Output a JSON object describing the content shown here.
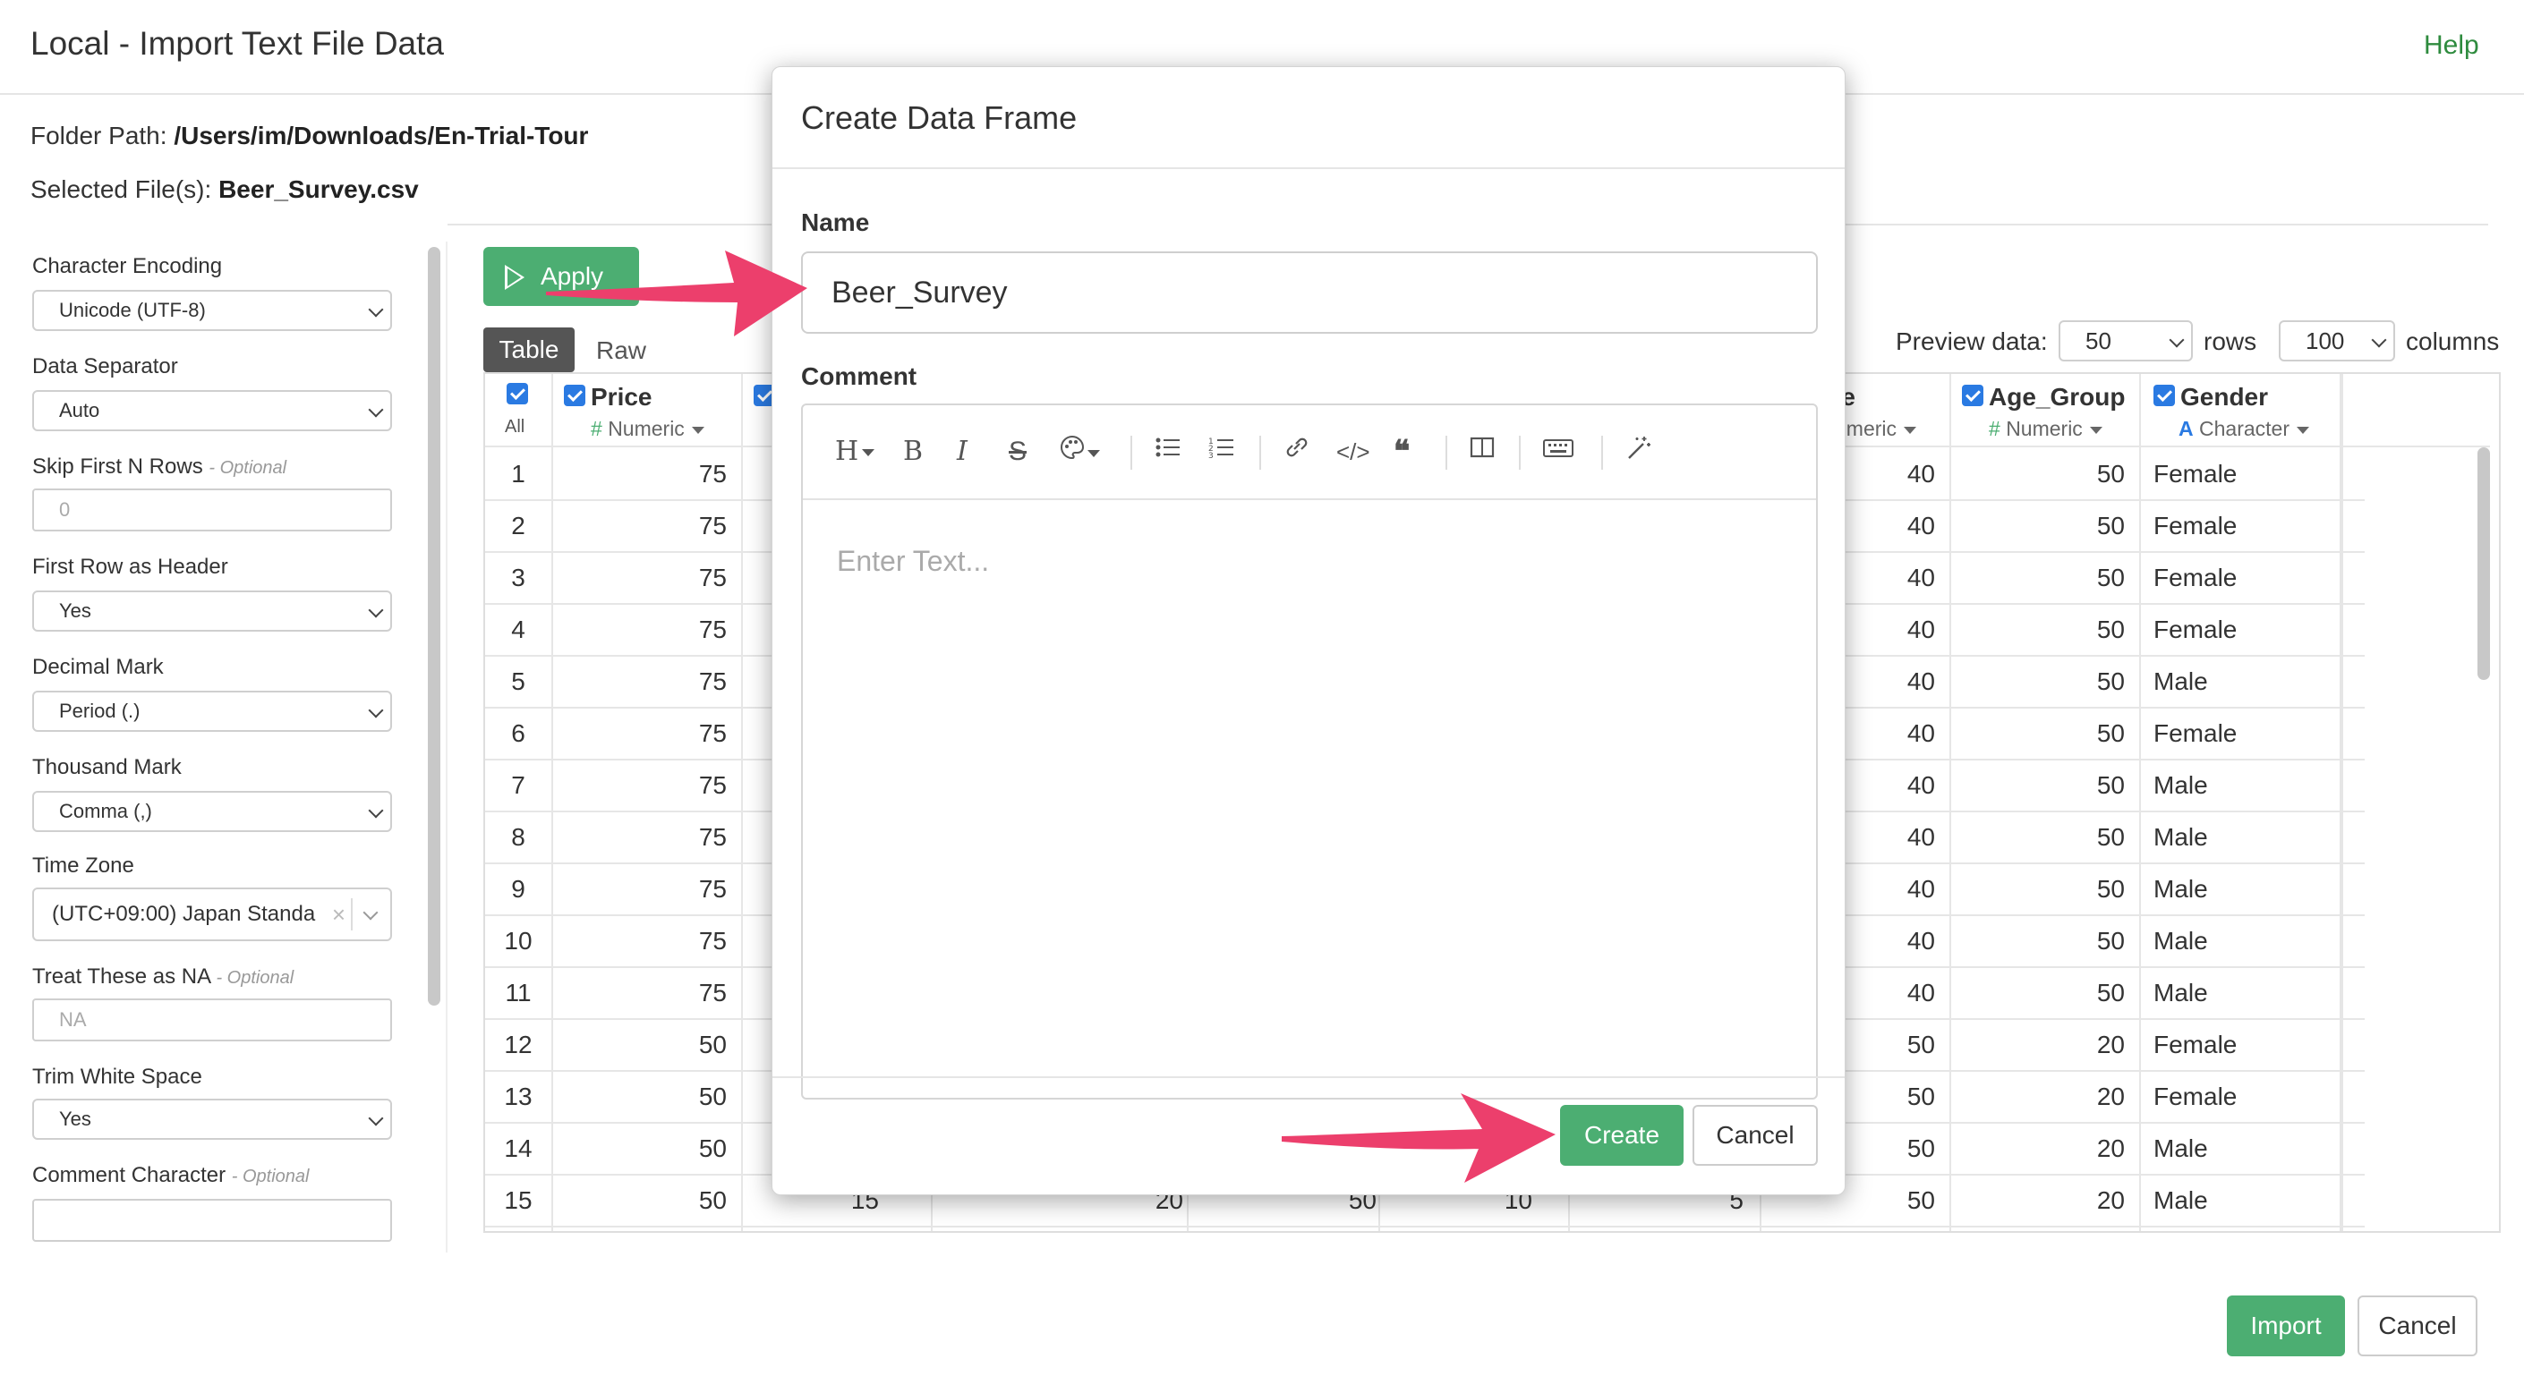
{
  "header": {
    "title": "Local - Import Text File Data",
    "help_label": "Help",
    "folder_path_label": "Folder Path:",
    "folder_path": "/Users/im/Downloads/En-Trial-Tour",
    "selected_files_label": "Selected File(s):",
    "selected_file": "Beer_Survey.csv"
  },
  "settings": {
    "character_encoding": {
      "label": "Character Encoding",
      "value": "Unicode (UTF-8)"
    },
    "data_separator": {
      "label": "Data Separator",
      "value": "Auto"
    },
    "skip_rows": {
      "label": "Skip First N Rows",
      "optional": "- Optional",
      "placeholder": "0"
    },
    "first_row_header": {
      "label": "First Row as Header",
      "value": "Yes"
    },
    "decimal_mark": {
      "label": "Decimal Mark",
      "value": "Period (.)"
    },
    "thousand_mark": {
      "label": "Thousand Mark",
      "value": "Comma (,)"
    },
    "time_zone": {
      "label": "Time Zone",
      "value": "(UTC+09:00) Japan Standa"
    },
    "treat_na": {
      "label": "Treat These as NA",
      "optional": "- Optional",
      "placeholder": "NA"
    },
    "trim_white_space": {
      "label": "Trim White Space",
      "value": "Yes"
    },
    "comment_character": {
      "label": "Comment Character",
      "optional": "- Optional",
      "value": ""
    }
  },
  "toolbar": {
    "apply_label": "Apply",
    "tab_table": "Table",
    "tab_raw": "Raw",
    "preview_label": "Preview data:",
    "rows_value": "50",
    "rows_label": "rows",
    "columns_value": "100",
    "columns_label": "columns"
  },
  "table": {
    "all_label": "All",
    "columns": [
      {
        "name": "Price",
        "type": "Numeric",
        "type_icon": "#"
      },
      {
        "name": "te",
        "type": "umeric",
        "type_icon": ""
      },
      {
        "name": "Age_Group",
        "type": "Numeric",
        "type_icon": "#"
      },
      {
        "name": "Gender",
        "type": "Character",
        "type_icon": "A"
      }
    ],
    "rows": [
      {
        "n": "1",
        "price": "75",
        "rate": "40",
        "age": "50",
        "gender": "Female"
      },
      {
        "n": "2",
        "price": "75",
        "rate": "40",
        "age": "50",
        "gender": "Female"
      },
      {
        "n": "3",
        "price": "75",
        "rate": "40",
        "age": "50",
        "gender": "Female"
      },
      {
        "n": "4",
        "price": "75",
        "rate": "40",
        "age": "50",
        "gender": "Female"
      },
      {
        "n": "5",
        "price": "75",
        "rate": "40",
        "age": "50",
        "gender": "Male"
      },
      {
        "n": "6",
        "price": "75",
        "rate": "40",
        "age": "50",
        "gender": "Female"
      },
      {
        "n": "7",
        "price": "75",
        "rate": "40",
        "age": "50",
        "gender": "Male"
      },
      {
        "n": "8",
        "price": "75",
        "rate": "40",
        "age": "50",
        "gender": "Male"
      },
      {
        "n": "9",
        "price": "75",
        "rate": "40",
        "age": "50",
        "gender": "Male"
      },
      {
        "n": "10",
        "price": "75",
        "rate": "40",
        "age": "50",
        "gender": "Male"
      },
      {
        "n": "11",
        "price": "75",
        "rate": "40",
        "age": "50",
        "gender": "Male"
      },
      {
        "n": "12",
        "price": "50",
        "rate": "50",
        "age": "20",
        "gender": "Female"
      },
      {
        "n": "13",
        "price": "50",
        "rate": "50",
        "age": "20",
        "gender": "Female"
      },
      {
        "n": "14",
        "price": "50",
        "rate": "50",
        "age": "20",
        "gender": "Male"
      },
      {
        "n": "15",
        "price": "50",
        "rate": "50",
        "age": "20",
        "gender": "Male"
      }
    ],
    "partial_row15": [
      "15",
      "20",
      "50",
      "10",
      "5"
    ]
  },
  "footer": {
    "import_label": "Import",
    "cancel_label": "Cancel"
  },
  "modal": {
    "title": "Create Data Frame",
    "name_label": "Name",
    "name_value": "Beer_Survey",
    "comment_label": "Comment",
    "comment_placeholder": "Enter Text...",
    "create_label": "Create",
    "cancel_label": "Cancel",
    "toolbar_glyphs": {
      "heading": "H",
      "bold": "B",
      "italic": "I",
      "strike": "S",
      "code": "</>",
      "quote": "66"
    }
  },
  "colors": {
    "accent_green": "#4cae72",
    "checkbox_blue": "#2a7ae2",
    "arrow_pink": "#ec3f6c",
    "help_green": "#2e8b3e"
  }
}
